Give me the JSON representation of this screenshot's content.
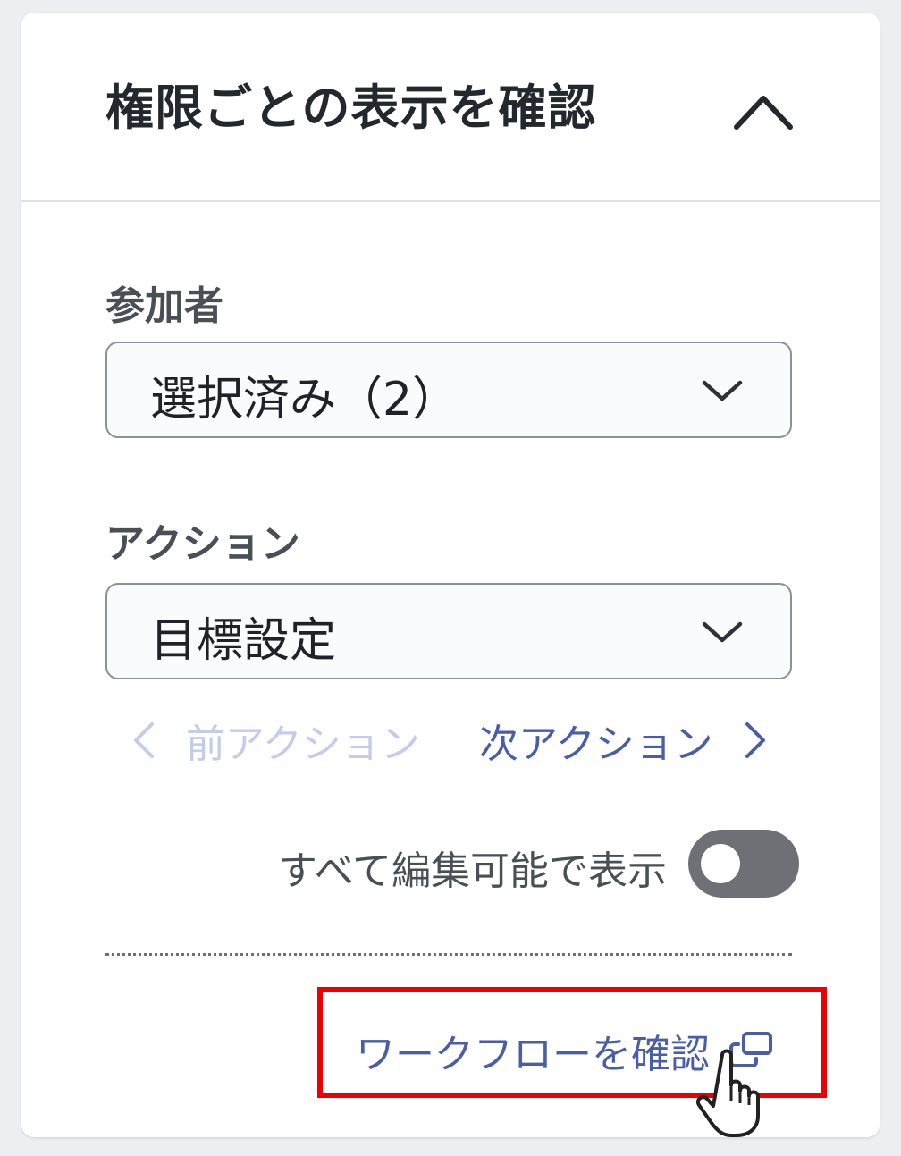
{
  "panel": {
    "title": "権限ごとの表示を確認",
    "collapse_icon": "chevron-up-icon"
  },
  "participants": {
    "label": "参加者",
    "value": "選択済み（2）",
    "icon": "chevron-down-icon"
  },
  "action": {
    "label": "アクション",
    "value": "目標設定",
    "icon": "chevron-down-icon"
  },
  "navigation": {
    "prev_label": "前アクション",
    "prev_enabled": false,
    "next_label": "次アクション",
    "next_enabled": true
  },
  "edit_toggle": {
    "label": "すべて編集可能で表示",
    "on": false
  },
  "workflow": {
    "label": "ワークフローを確認",
    "icon": "external-link-icon"
  },
  "colors": {
    "link": "#4a5ea8",
    "link_disabled": "#c3cce8",
    "toggle_off": "#6f7076",
    "highlight": "#ee0000"
  }
}
